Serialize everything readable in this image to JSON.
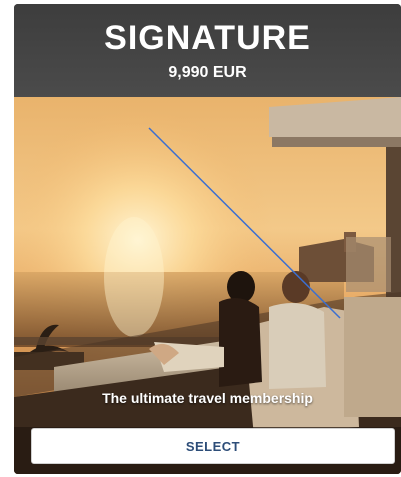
{
  "card": {
    "title": "SIGNATURE",
    "price": "9,990 EUR",
    "tagline": "The ultimate travel membership",
    "select_label": "SELECT"
  },
  "colors": {
    "header_bg": "#444444",
    "button_text": "#2d4d78",
    "overlay_line": "#3b6fd1"
  },
  "photo": {
    "subject": "couple-on-balcony-sunset-image"
  }
}
